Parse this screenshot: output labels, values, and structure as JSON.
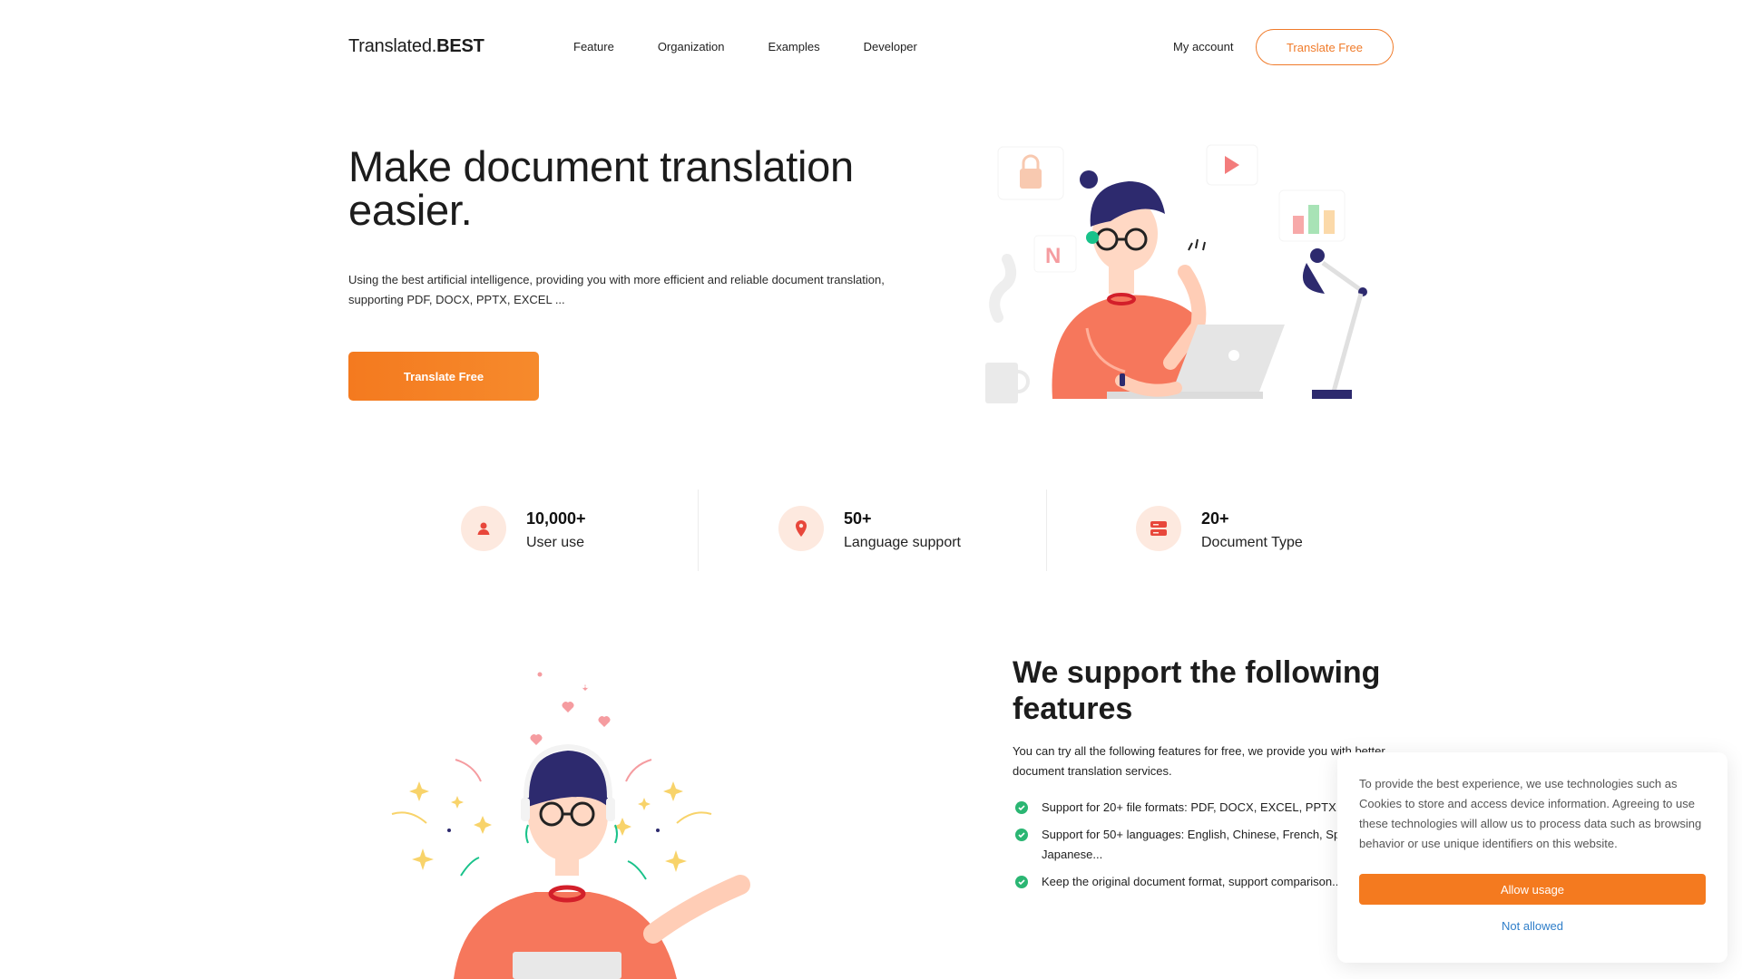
{
  "header": {
    "logo_text": "Translated.",
    "logo_bold": "BEST",
    "nav": [
      {
        "label": "Feature"
      },
      {
        "label": "Organization"
      },
      {
        "label": "Examples"
      },
      {
        "label": "Developer"
      }
    ],
    "my_account": "My account",
    "cta": "Translate Free"
  },
  "hero": {
    "title": "Make document translation easier.",
    "description": "Using the best artificial intelligence, providing you with more efficient and reliable document translation, supporting PDF, DOCX, PPTX, EXCEL ...",
    "cta": "Translate Free"
  },
  "stats": [
    {
      "value": "10,000+",
      "label": "User use",
      "icon": "user-icon"
    },
    {
      "value": "50+",
      "label": "Language support",
      "icon": "location-pin-icon"
    },
    {
      "value": "20+",
      "label": "Document Type",
      "icon": "document-type-icon"
    }
  ],
  "features": {
    "title": "We support the following features",
    "description": "You can try all the following features for free, we provide you with better document translation services.",
    "items": [
      {
        "text": "Support for 20+ file formats: PDF, DOCX, EXCEL, PPTX, EPUB..."
      },
      {
        "text": "Support for 50+ languages: English, Chinese, French, Spanish, Japanese..."
      },
      {
        "text": "Keep the original document format, support comparison..."
      }
    ]
  },
  "cookie": {
    "text": "To provide the best experience, we use technologies such as Cookies to store and access device information. Agreeing to use these technologies will allow us to process data such as browsing behavior or use unique identifiers on this website.",
    "allow": "Allow usage",
    "deny": "Not allowed"
  },
  "colors": {
    "accent": "#f47a1f",
    "check": "#2bb673",
    "link": "#2f7ec9",
    "icon_bg": "#fde9df"
  }
}
